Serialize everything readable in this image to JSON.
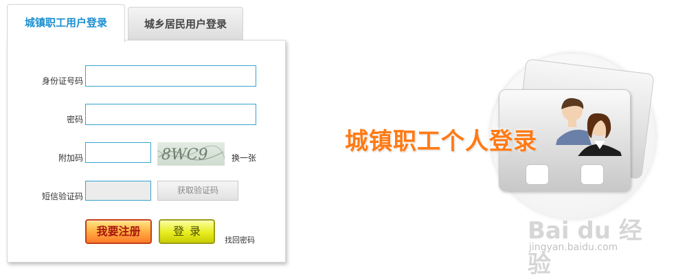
{
  "tabs": {
    "active_label": "城镇职工用户登录",
    "inactive_label": "城乡居民用户登录"
  },
  "form": {
    "id_label": "身份证号码",
    "id_value": "",
    "password_label": "密码",
    "password_value": "",
    "captcha_label": "附加码",
    "captcha_value": "",
    "captcha_image_text": "8WC9",
    "change_captcha": "换一张",
    "sms_label": "短信验证码",
    "sms_value": "",
    "sms_button": "获取验证码"
  },
  "buttons": {
    "register": "我要注册",
    "login": "登录",
    "forgot": "找回密码"
  },
  "banner": {
    "title": "城镇职工个人登录"
  },
  "watermark": {
    "brand": "Bai du 经验",
    "url": "jingyan.baidu.com"
  },
  "colors": {
    "active_tab_text": "#1b8fd0",
    "input_border": "#35a3cf",
    "register_button": "#ff7a2a",
    "login_button": "#e7ed1f",
    "banner_title": "#ff7a14"
  }
}
